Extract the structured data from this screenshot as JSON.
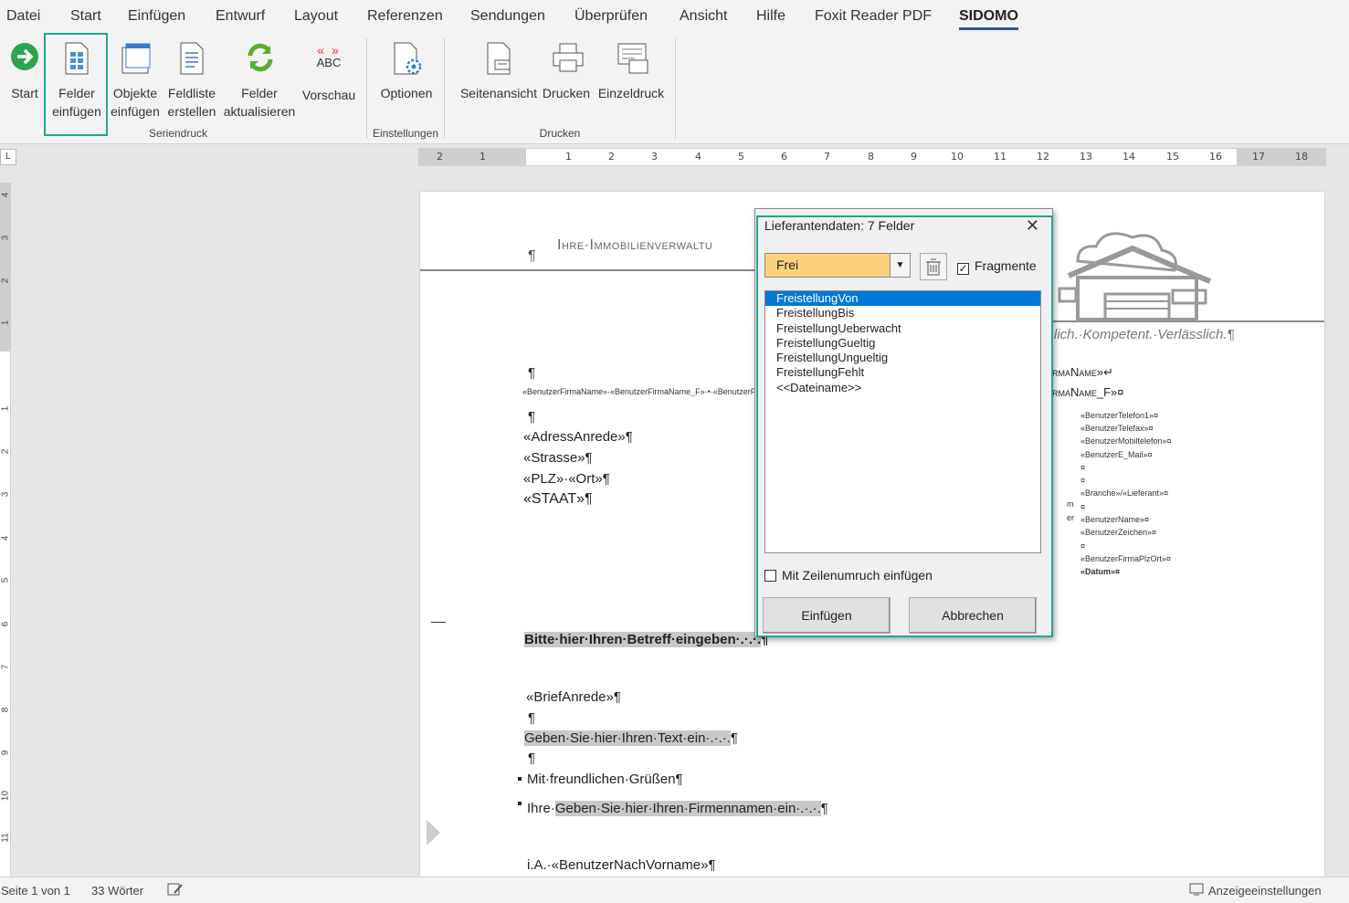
{
  "tabs": [
    "Datei",
    "Start",
    "Einfügen",
    "Entwurf",
    "Layout",
    "Referenzen",
    "Sendungen",
    "Überprüfen",
    "Ansicht",
    "Hilfe",
    "Foxit Reader PDF",
    "SIDOMO"
  ],
  "ribbon": {
    "buttons": [
      {
        "line1": "Start",
        "line2": "",
        "icon": "arrow-right-icon"
      },
      {
        "line1": "Felder",
        "line2": "einfügen",
        "icon": "insert-fields-icon"
      },
      {
        "line1": "Objekte",
        "line2": "einfügen",
        "icon": "insert-objects-icon"
      },
      {
        "line1": "Feldliste",
        "line2": "erstellen",
        "icon": "field-list-icon"
      },
      {
        "line1": "Felder",
        "line2": "aktualisieren",
        "icon": "refresh-icon"
      },
      {
        "line1": "Vorschau",
        "line2": "",
        "icon": "preview-abc-icon",
        "icon_text": "ABC"
      },
      {
        "line1": "Optionen",
        "line2": "",
        "icon": "options-gear-icon"
      },
      {
        "line1": "Seitenansicht",
        "line2": "",
        "icon": "page-view-icon"
      },
      {
        "line1": "Drucken",
        "line2": "",
        "icon": "printer-icon"
      },
      {
        "line1": "Einzeldruck",
        "line2": "",
        "icon": "single-print-icon"
      }
    ],
    "groups": [
      "Seriendruck",
      "Einstellungen",
      "Drucken"
    ]
  },
  "ruler": {
    "h_numbers": [
      "2",
      "1",
      "1",
      "2",
      "3",
      "4",
      "5",
      "6",
      "7",
      "8",
      "9",
      "10",
      "11",
      "12",
      "13",
      "14",
      "15",
      "16",
      "17",
      "18"
    ],
    "v_numbers": [
      "4",
      "3",
      "2",
      "1",
      "1",
      "2",
      "3",
      "4",
      "5",
      "6",
      "7",
      "8",
      "9",
      "10",
      "11"
    ]
  },
  "document": {
    "header_title": "Ihre·Immobilienverwaltu",
    "pilcrow": "¶",
    "slogan": "lich.·Kompetent.·Verlässlich.¶",
    "company_line": "«BenutzerFirmaName»·«BenutzerFirmaName_F»·•·«BenutzerFirmaS",
    "right_firma1": "rmaName»↵",
    "right_firma2": "rmaName_F»¤",
    "right_fields": [
      "«BenutzerTelefon1»¤",
      "«BenutzerTelefax»¤",
      "«BenutzerMobiltelefon»¤",
      "«BenutzerE_Mail»¤",
      "¤",
      "¤",
      "«Branche»/«Lieferant»¤",
      "¤",
      "«BenutzerName»¤",
      "«BenutzerZeichen»¤",
      "¤",
      "«BenutzerFirmaPlzOrt»¤",
      "«Datum»¤"
    ],
    "mid_fragments": [
      "m",
      "er"
    ],
    "address": [
      "«AdressAnrede»¶",
      "«Strasse»¶",
      "«PLZ»·«Ort»¶",
      "«STAAT»¶"
    ],
    "subject": "Bitte·hier·Ihren·Betreff·eingeben·.·.·.",
    "salutation": "«BriefAnrede»¶",
    "text_placeholder": "Geben·Sie·hier·Ihren·Text·ein·.·.·.",
    "closing": "Mit·freundlichen·Grüßen¶",
    "company_prefix": "Ihre·",
    "company_placeholder": "Geben·Sie·hier·Ihren·Firmennamen·ein·.·.·.",
    "signature": "i.A.·«BenutzerNachVorname»¶"
  },
  "dialog": {
    "title": "Lieferantendaten: 7 Felder",
    "close": "✕",
    "select_value": "Frei",
    "fragmente_label": "Fragmente",
    "fragmente_checked": "✓",
    "fields": [
      "FreistellungVon",
      "FreistellungBis",
      "FreistellungUeberwacht",
      "FreistellungGueltig",
      "FreistellungUngueltig",
      "FreistellungFehlt",
      "<<Dateiname>>"
    ],
    "selected_index": 0,
    "wrap_label": "Mit Zeilenumruch einfügen",
    "insert_button": "Einfügen",
    "cancel_button": "Abbrechen"
  },
  "status": {
    "page": "Seite 1 von 1",
    "words": "33 Wörter",
    "display_settings": "Anzeigeeinstellungen"
  },
  "colors": {
    "accent": "#2b579a",
    "highlight_box": "#22a58f",
    "select_bg": "#fcd17c",
    "list_selected": "#0078d7"
  }
}
